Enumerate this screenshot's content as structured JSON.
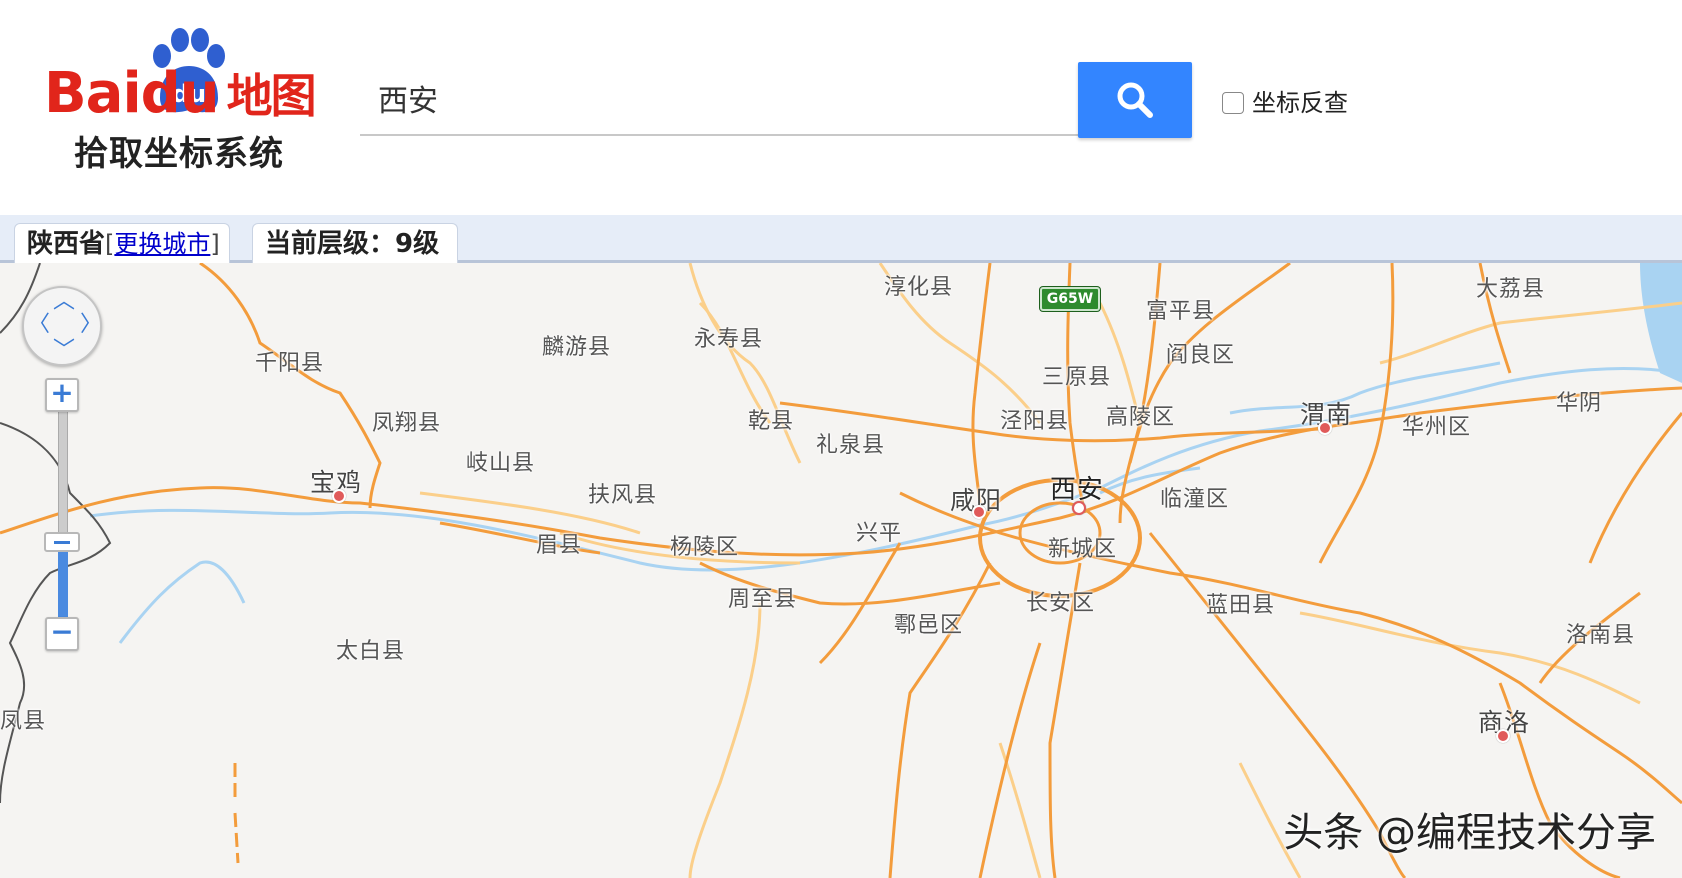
{
  "logo": {
    "brand": "Baidu",
    "brand_suffix": "地图",
    "subtitle": "拾取坐标系统"
  },
  "search": {
    "value": "西安",
    "button_icon": "search-icon"
  },
  "reverse_lookup": {
    "label": "坐标反查",
    "checked": false
  },
  "infobar": {
    "city": "陕西省",
    "change_city_open": "[",
    "change_city": "更换城市",
    "change_city_close": "]",
    "level_text": "当前层级：9级"
  },
  "map": {
    "highway_shield": "G65W",
    "places": {
      "xian": "西安",
      "xianyang": "咸阳",
      "baoji": "宝鸡",
      "weinan": "渭南",
      "shangluo": "商洛",
      "chunhua": "淳化县",
      "fuping": "富平县",
      "dali": "大荔县",
      "qianyang": "千阳县",
      "linyou": "麟游县",
      "yongshou": "永寿县",
      "sanyuan": "三原县",
      "yanliang": "阎良区",
      "fengxiang": "凤翔县",
      "qianxian": "乾县",
      "jingyang": "泾阳县",
      "gaoling": "高陵区",
      "huazhou": "华州区",
      "huayin": "华阴",
      "qishan": "岐山县",
      "liquan": "礼泉县",
      "fufeng": "扶风县",
      "lintong": "临潼区",
      "xingping": "兴平",
      "meixian": "眉县",
      "yangling": "杨陵区",
      "xincheng": "新城区",
      "zhouzhi": "周至县",
      "lantian": "蓝田县",
      "changan": "长安区",
      "huyi": "鄠邑区",
      "taibai": "太白县",
      "luonan": "洛南县",
      "fengxian": "凤县"
    }
  },
  "controls": {
    "zoom_in": "+",
    "zoom_out": "−",
    "zoom_level_fraction": 0.45
  },
  "watermark": "头条 @编程技术分享",
  "colors": {
    "accent": "#3385ff",
    "road_major": "#f39c3c",
    "road_minor": "#fbcf8a",
    "river": "#a9d3f2",
    "border": "#555555"
  }
}
